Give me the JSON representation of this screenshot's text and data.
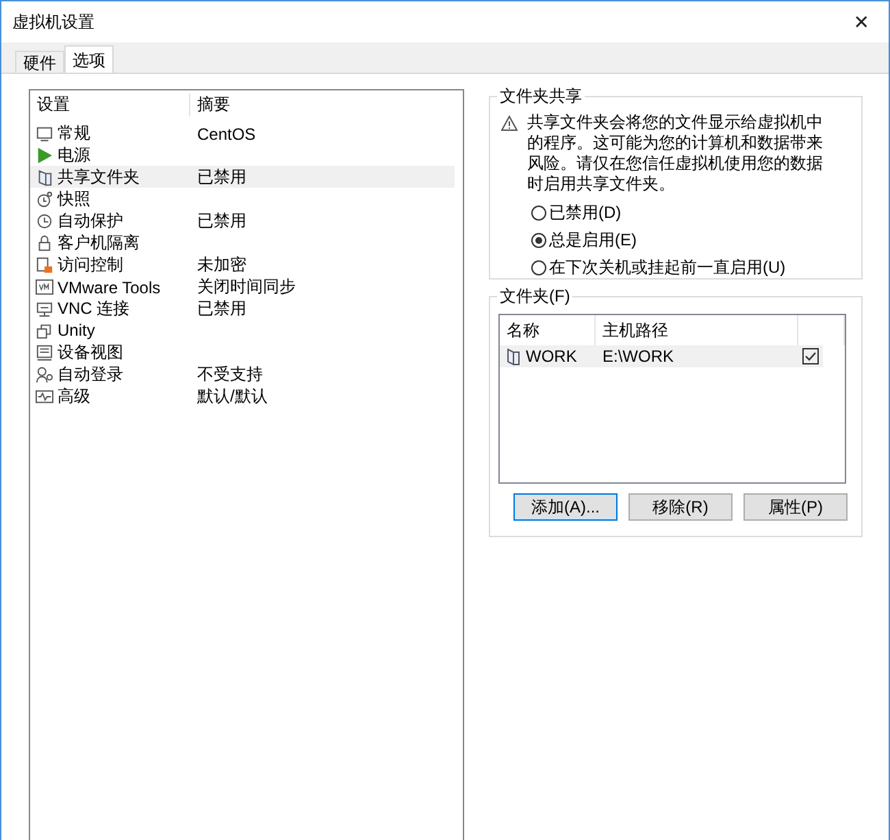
{
  "window": {
    "title": "虚拟机设置",
    "close": "✕"
  },
  "tabs": [
    {
      "label": "硬件",
      "selected": false
    },
    {
      "label": "选项",
      "selected": true
    }
  ],
  "settings": {
    "columns": [
      "设置",
      "摘要"
    ],
    "items": [
      {
        "name": "常规",
        "summary": "CentOS",
        "selected": false
      },
      {
        "name": "电源",
        "selected": false
      },
      {
        "name": "共享文件夹",
        "summary": "已禁用",
        "selected": true
      },
      {
        "name": "快照",
        "selected": false
      },
      {
        "name": "自动保护",
        "summary": "已禁用",
        "selected": false
      },
      {
        "name": "客户机隔离",
        "selected": false
      },
      {
        "name": "访问控制",
        "summary": "未加密",
        "selected": false
      },
      {
        "name": "VMware Tools",
        "summary": "关闭时间同步",
        "selected": false
      },
      {
        "name": "VNC 连接",
        "summary": "已禁用",
        "selected": false
      },
      {
        "name": "Unity",
        "selected": false
      },
      {
        "name": "设备视图",
        "selected": false
      },
      {
        "name": "自动登录",
        "summary": "不受支持",
        "selected": false
      },
      {
        "name": "高级",
        "summary": "默认/默认",
        "selected": false
      }
    ]
  },
  "sharing": {
    "title": "文件夹共享",
    "warning": "共享文件夹会将您的文件显示给虚拟机中的程序。这可能为您的计算机和数据带来风险。请仅在您信任虚拟机使用您的数据时启用共享文件夹。",
    "options": [
      {
        "label": "已禁用(D)",
        "selected": false
      },
      {
        "label": "总是启用(E)",
        "selected": true
      },
      {
        "label": "在下次关机或挂起前一直启用(U)",
        "selected": false
      }
    ]
  },
  "folders": {
    "title": "文件夹(F)",
    "columns": [
      "名称",
      "主机路径"
    ],
    "rows": [
      {
        "name": "WORK",
        "path": "E:\\WORK",
        "checked": true,
        "selected": true
      }
    ],
    "buttons": [
      {
        "label": "添加(A)...",
        "focused": true
      },
      {
        "label": "移除(R)",
        "focused": false
      },
      {
        "label": "属性(P)",
        "focused": false
      }
    ]
  }
}
